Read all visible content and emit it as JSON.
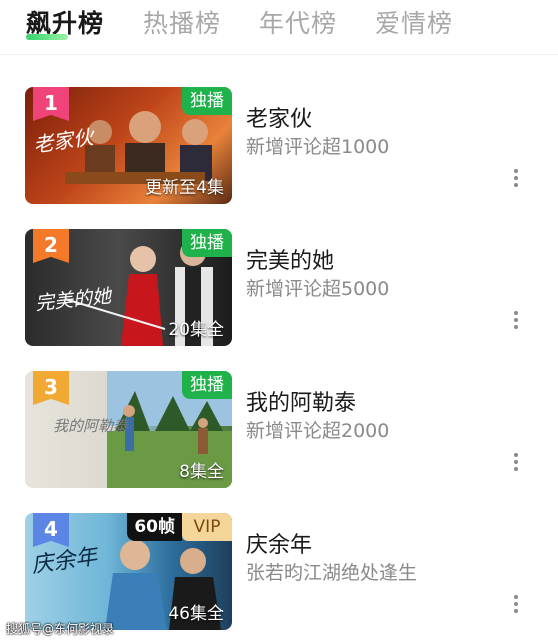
{
  "tabs": [
    {
      "label": "飙升榜",
      "active": true
    },
    {
      "label": "热播榜",
      "active": false
    },
    {
      "label": "年代榜",
      "active": false
    },
    {
      "label": "爱情榜",
      "active": false
    }
  ],
  "items": [
    {
      "rank": "1",
      "title": "老家伙",
      "subtitle": "新增评论超1000",
      "badge": "独播",
      "episodes": "更新至4集",
      "thumb_text": "老家伙",
      "rank_color": "#f0437a"
    },
    {
      "rank": "2",
      "title": "完美的她",
      "subtitle": "新增评论超5000",
      "badge": "独播",
      "episodes": "20集全",
      "thumb_text": "完美的她",
      "rank_color": "#f47a2a"
    },
    {
      "rank": "3",
      "title": "我的阿勒泰",
      "subtitle": "新增评论超2000",
      "badge": "独播",
      "episodes": "8集全",
      "thumb_text": "我的阿勒泰",
      "rank_color": "#f2a934"
    },
    {
      "rank": "4",
      "title": "庆余年",
      "subtitle": "张若昀江湖绝处逢生",
      "badge_fps": "60帧",
      "badge_vip": "VIP",
      "episodes": "46集全",
      "thumb_text": "庆余年",
      "rank_color": "#5b86e5"
    }
  ],
  "watermark": "搜狐号@东何影视录",
  "colors": {
    "accent": "#1fb24a",
    "title": "#1a1a1a",
    "subtitle": "#8a8a8a",
    "tab_inactive": "#a8a8a8"
  }
}
